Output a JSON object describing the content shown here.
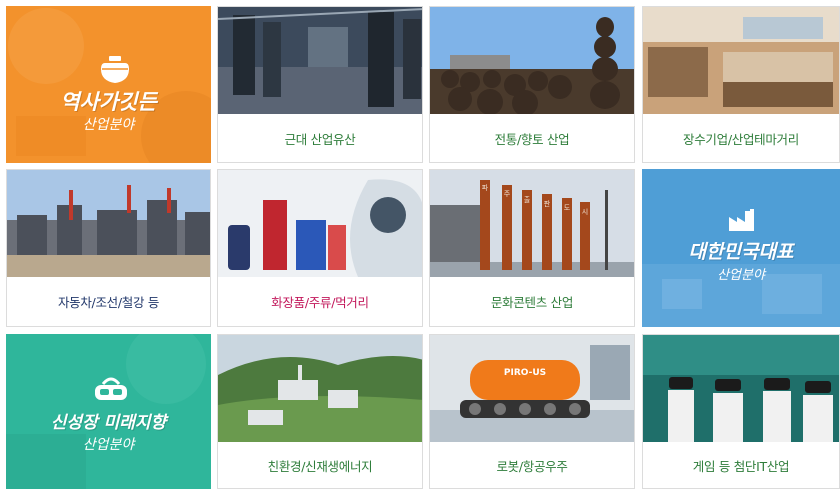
{
  "colors": {
    "orange": "#f3922c",
    "blue": "#4f9ed6",
    "teal": "#2fb69b",
    "label_green": "#2e7d3a",
    "label_navy": "#22386b",
    "label_pink": "#c2185b",
    "label_dark": "#333333"
  },
  "features": {
    "heritage": {
      "title": "역사가깃든",
      "subtitle": "산업분야",
      "icon": "pot-icon"
    },
    "korea": {
      "title": "대한민국대표",
      "subtitle": "산업분야",
      "icon": "factory-icon"
    },
    "future": {
      "title": "신성장 미래지향",
      "subtitle": "산업분야",
      "icon": "vr-headset-icon"
    }
  },
  "cards": [
    {
      "label": "근대 산업유산",
      "color": "label_green"
    },
    {
      "label": "전통/향토 산업",
      "color": "label_green"
    },
    {
      "label": "장수기업/산업테마거리",
      "color": "label_green"
    },
    {
      "label": "자동차/조선/철강 등",
      "color": "label_navy"
    },
    {
      "label": "화장품/주류/먹거리",
      "color": "label_pink"
    },
    {
      "label": "문화콘텐츠 산업",
      "color": "label_green"
    },
    {
      "label": "친환경/신재생에너지",
      "color": "label_green"
    },
    {
      "label": "로봇/항공우주",
      "color": "label_green"
    },
    {
      "label": "게임 등 첨단IT산업",
      "color": "label_green"
    }
  ],
  "photo_text": {
    "sign_chars": [
      "파",
      "주",
      "출",
      "판",
      "도",
      "시"
    ],
    "robot_brand": "PIRO-US"
  }
}
